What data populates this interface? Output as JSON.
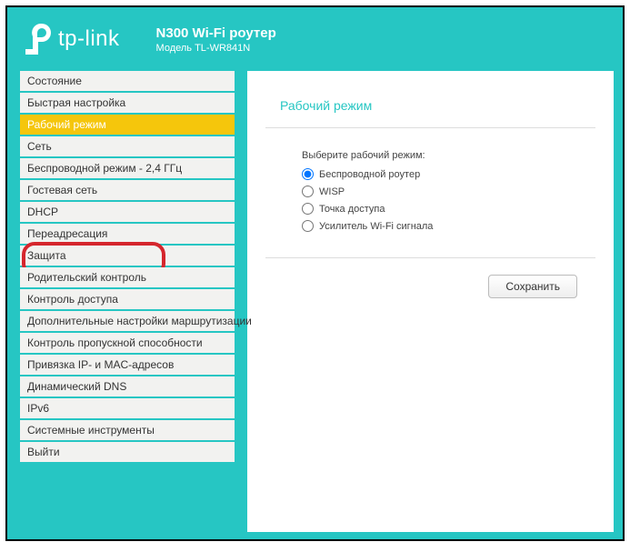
{
  "brand": "tp-link",
  "header": {
    "title": "N300 Wi-Fi роутер",
    "model": "Модель TL-WR841N"
  },
  "sidebar": {
    "items": [
      {
        "label": "Состояние"
      },
      {
        "label": "Быстрая настройка"
      },
      {
        "label": "Рабочий режим",
        "active": true
      },
      {
        "label": "Сеть"
      },
      {
        "label": "Беспроводной режим - 2,4 ГГц"
      },
      {
        "label": "Гостевая сеть"
      },
      {
        "label": "DHCP"
      },
      {
        "label": "Переадресация"
      },
      {
        "label": "Защита",
        "highlighted": true
      },
      {
        "label": "Родительский контроль"
      },
      {
        "label": "Контроль доступа"
      },
      {
        "label": "Дополнительные настройки маршрутизации"
      },
      {
        "label": "Контроль пропускной способности"
      },
      {
        "label": "Привязка IP- и MAC-адресов"
      },
      {
        "label": "Динамический DNS"
      },
      {
        "label": "IPv6"
      },
      {
        "label": "Системные инструменты"
      },
      {
        "label": "Выйти"
      }
    ]
  },
  "content": {
    "heading": "Рабочий режим",
    "prompt": "Выберите рабочий режим:",
    "options": [
      {
        "label": "Беспроводной роутер",
        "checked": true
      },
      {
        "label": "WISP",
        "checked": false
      },
      {
        "label": "Точка доступа",
        "checked": false
      },
      {
        "label": "Усилитель Wi-Fi сигнала",
        "checked": false
      }
    ],
    "save_label": "Сохранить"
  }
}
